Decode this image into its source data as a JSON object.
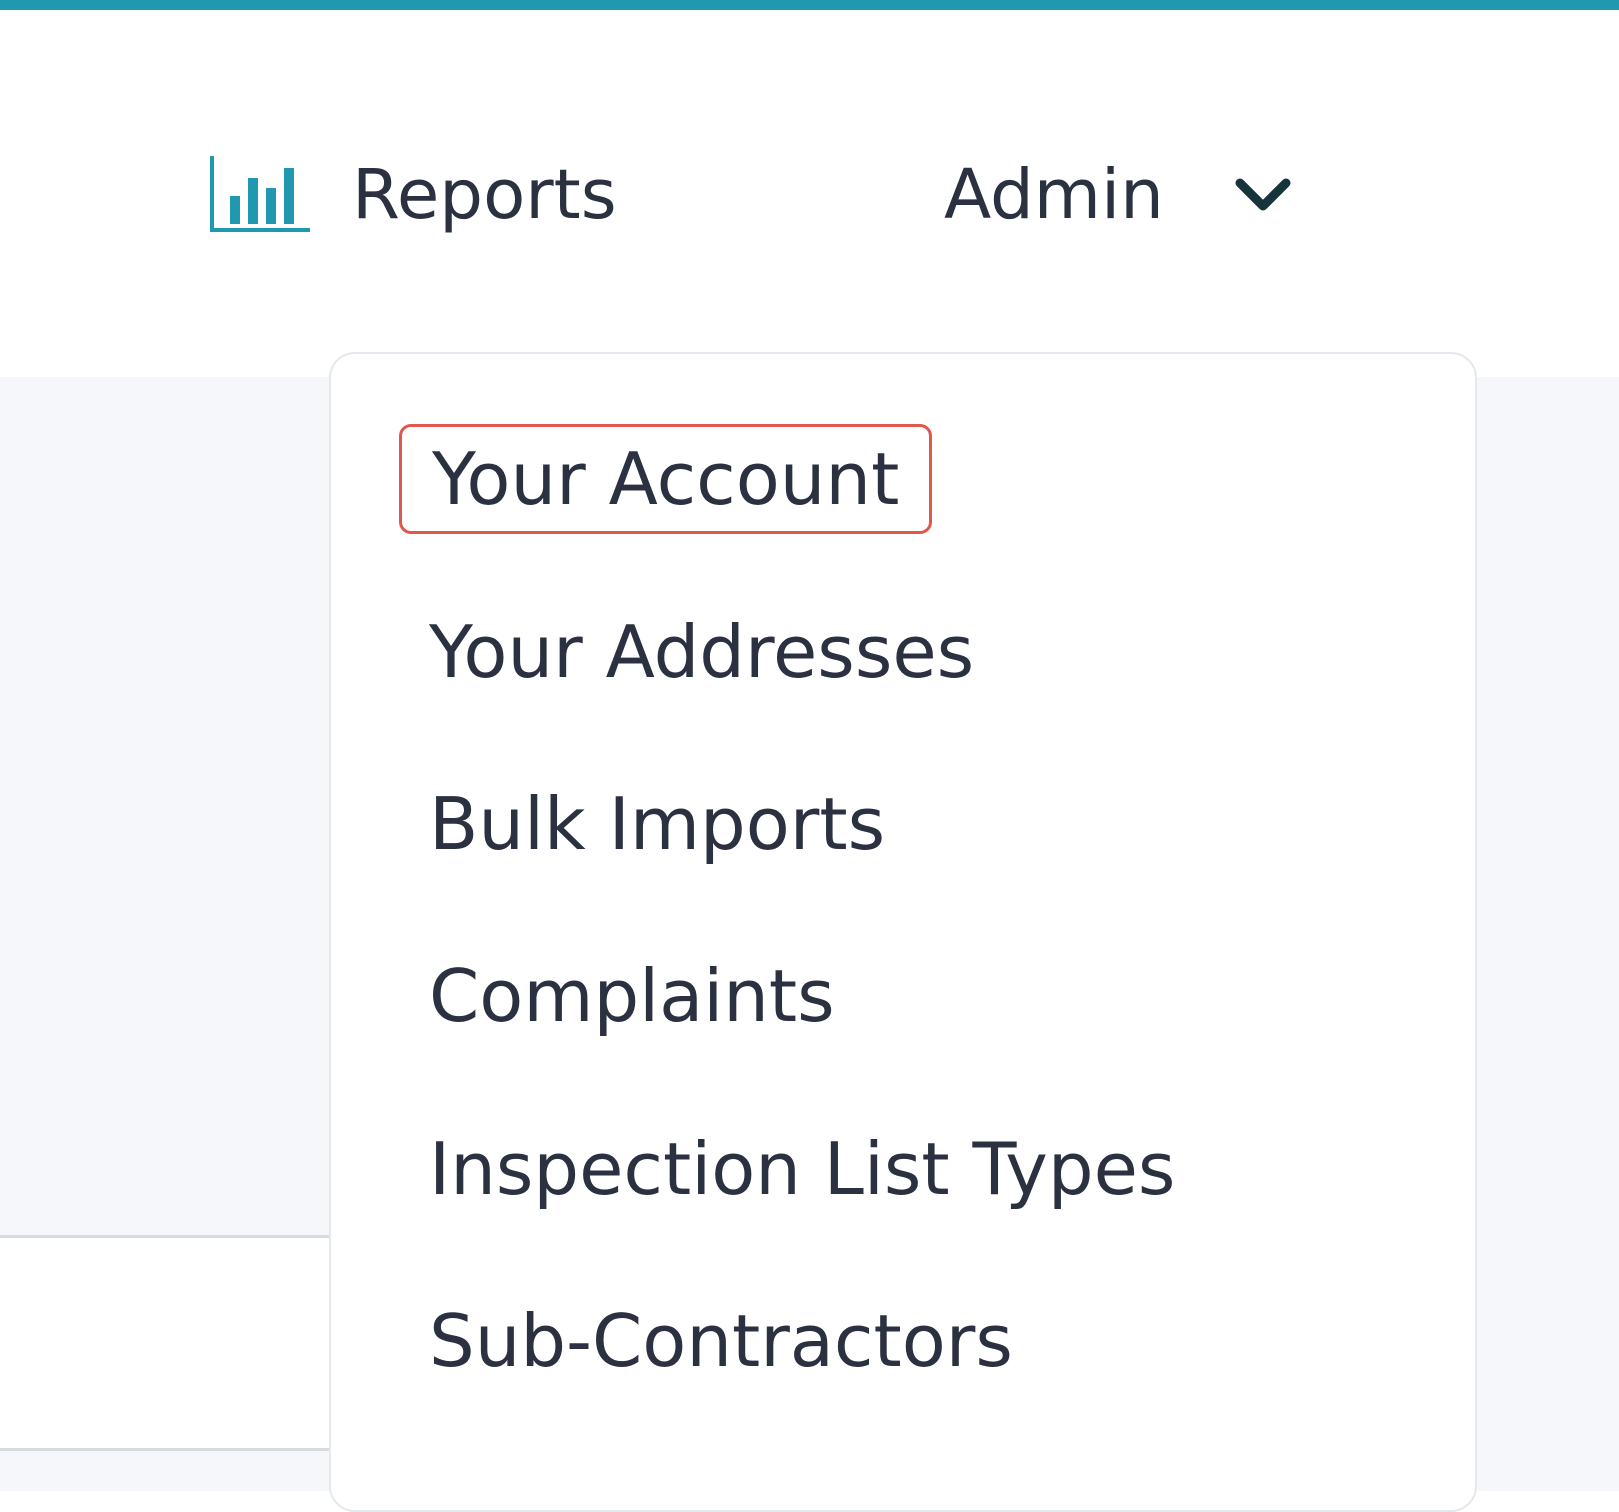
{
  "header": {
    "accent_color": "#1f98b0",
    "nav": {
      "reports": {
        "label": "Reports",
        "icon": "bar-chart-icon"
      },
      "admin": {
        "label": "Admin",
        "icon": "chevron-down-icon",
        "expanded": true
      }
    }
  },
  "admin_menu": {
    "items": [
      {
        "label": "Your Account",
        "highlighted": true
      },
      {
        "label": "Your Addresses"
      },
      {
        "label": "Bulk Imports"
      },
      {
        "label": "Complaints"
      },
      {
        "label": "Inspection List Types"
      },
      {
        "label": "Sub-Contractors"
      }
    ],
    "highlight_color": "#e2574c"
  }
}
